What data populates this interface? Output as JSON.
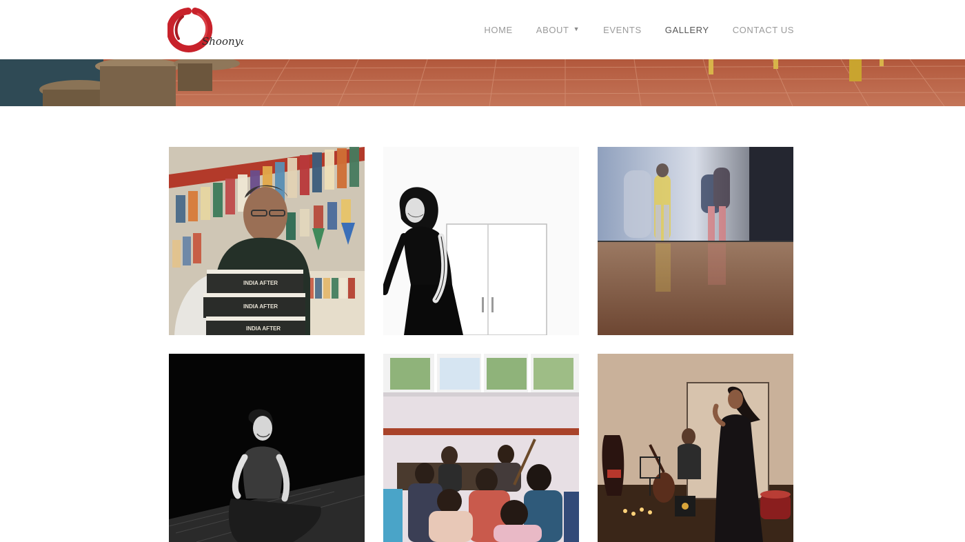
{
  "brand": {
    "logo_text": "Shoonya",
    "accent_color": "#c8222b"
  },
  "nav": {
    "items": [
      {
        "label": "HOME",
        "active": false
      },
      {
        "label": "ABOUT",
        "active": false,
        "has_dropdown": true
      },
      {
        "label": "EVENTS",
        "active": false
      },
      {
        "label": "GALLERY",
        "active": true
      },
      {
        "label": "CONTACT US",
        "active": false
      }
    ],
    "dropdown_icon": "caret-down-icon"
  },
  "gallery": {
    "photos": [
      {
        "subject": "bookstore-speaker"
      },
      {
        "subject": "performer-silhouette"
      },
      {
        "subject": "dancers-motion-blur"
      },
      {
        "subject": "seated-performer"
      },
      {
        "subject": "music-workshop"
      },
      {
        "subject": "storyteller-with-guitarist"
      }
    ]
  }
}
